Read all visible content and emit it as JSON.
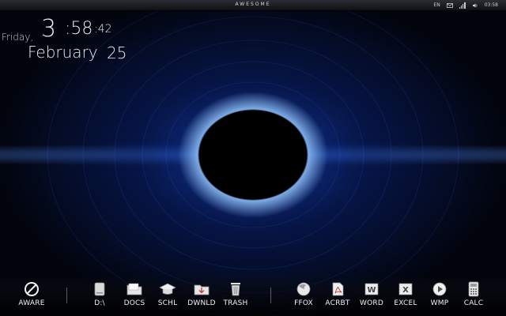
{
  "topbar": {
    "title": "AWESOME",
    "language": "EN",
    "time": "03:58"
  },
  "clock": {
    "day": "Friday,",
    "hour": "3",
    "minute": ":58",
    "second": ":42",
    "month": "February",
    "date": "25"
  },
  "dock": {
    "left": [
      {
        "label": "AWARE",
        "icon": "no-entry-icon"
      }
    ],
    "middle": [
      {
        "label": "D:\\",
        "icon": "drive-icon"
      },
      {
        "label": "DOCS",
        "icon": "folder-icon"
      },
      {
        "label": "SCHL",
        "icon": "graduation-cap-icon"
      },
      {
        "label": "DWNLD",
        "icon": "download-folder-icon"
      },
      {
        "label": "TRASH",
        "icon": "trash-icon"
      }
    ],
    "right": [
      {
        "label": "FFOX",
        "icon": "firefox-icon"
      },
      {
        "label": "ACRBT",
        "icon": "acrobat-icon"
      },
      {
        "label": "WORD",
        "icon": "word-icon"
      },
      {
        "label": "EXCEL",
        "icon": "excel-icon"
      },
      {
        "label": "WMP",
        "icon": "media-player-icon"
      },
      {
        "label": "CALC",
        "icon": "calculator-icon"
      }
    ]
  }
}
